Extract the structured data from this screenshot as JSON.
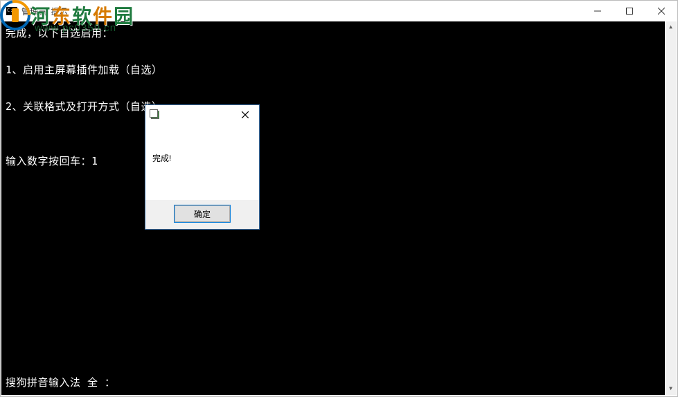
{
  "window": {
    "title": "管理员: 提示"
  },
  "console": {
    "lines": [
      "完成，以下自选启用：",
      "",
      "1、启用主屏幕插件加载（自选）",
      "",
      "2、关联格式及打开方式（自选）",
      "",
      "",
      "输入数字按回车：1"
    ],
    "bottom_line": "搜狗拼音输入法 全 ："
  },
  "dialog": {
    "message": "完成!",
    "ok_button": "确定"
  },
  "watermark": {
    "brand_chars": [
      "河",
      "东",
      "软",
      "件",
      "园"
    ],
    "url": "www.pc0359.cn"
  }
}
